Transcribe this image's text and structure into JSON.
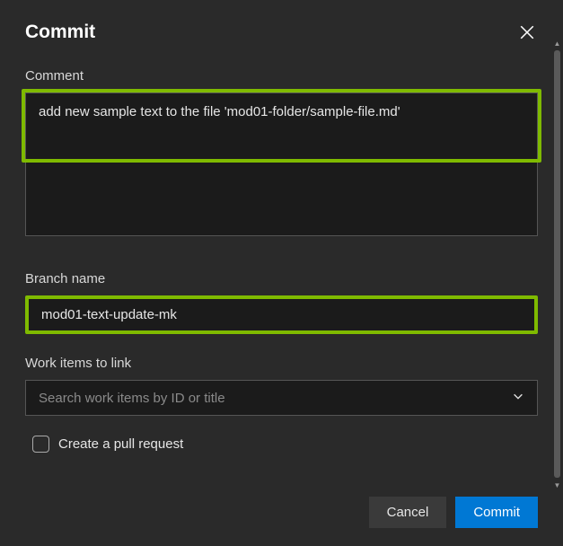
{
  "dialog": {
    "title": "Commit"
  },
  "comment": {
    "label": "Comment",
    "value": "add new sample text to the file 'mod01-folder/sample-file.md'"
  },
  "branch": {
    "label": "Branch name",
    "value": "mod01-text-update-mk"
  },
  "workitems": {
    "label": "Work items to link",
    "placeholder": "Search work items by ID or title"
  },
  "pullrequest": {
    "label": "Create a pull request",
    "checked": false
  },
  "buttons": {
    "cancel": "Cancel",
    "commit": "Commit"
  },
  "colors": {
    "highlight": "#7fba00",
    "primary": "#0078d4",
    "background": "#2a2a2a",
    "input_bg": "#1b1b1b"
  }
}
